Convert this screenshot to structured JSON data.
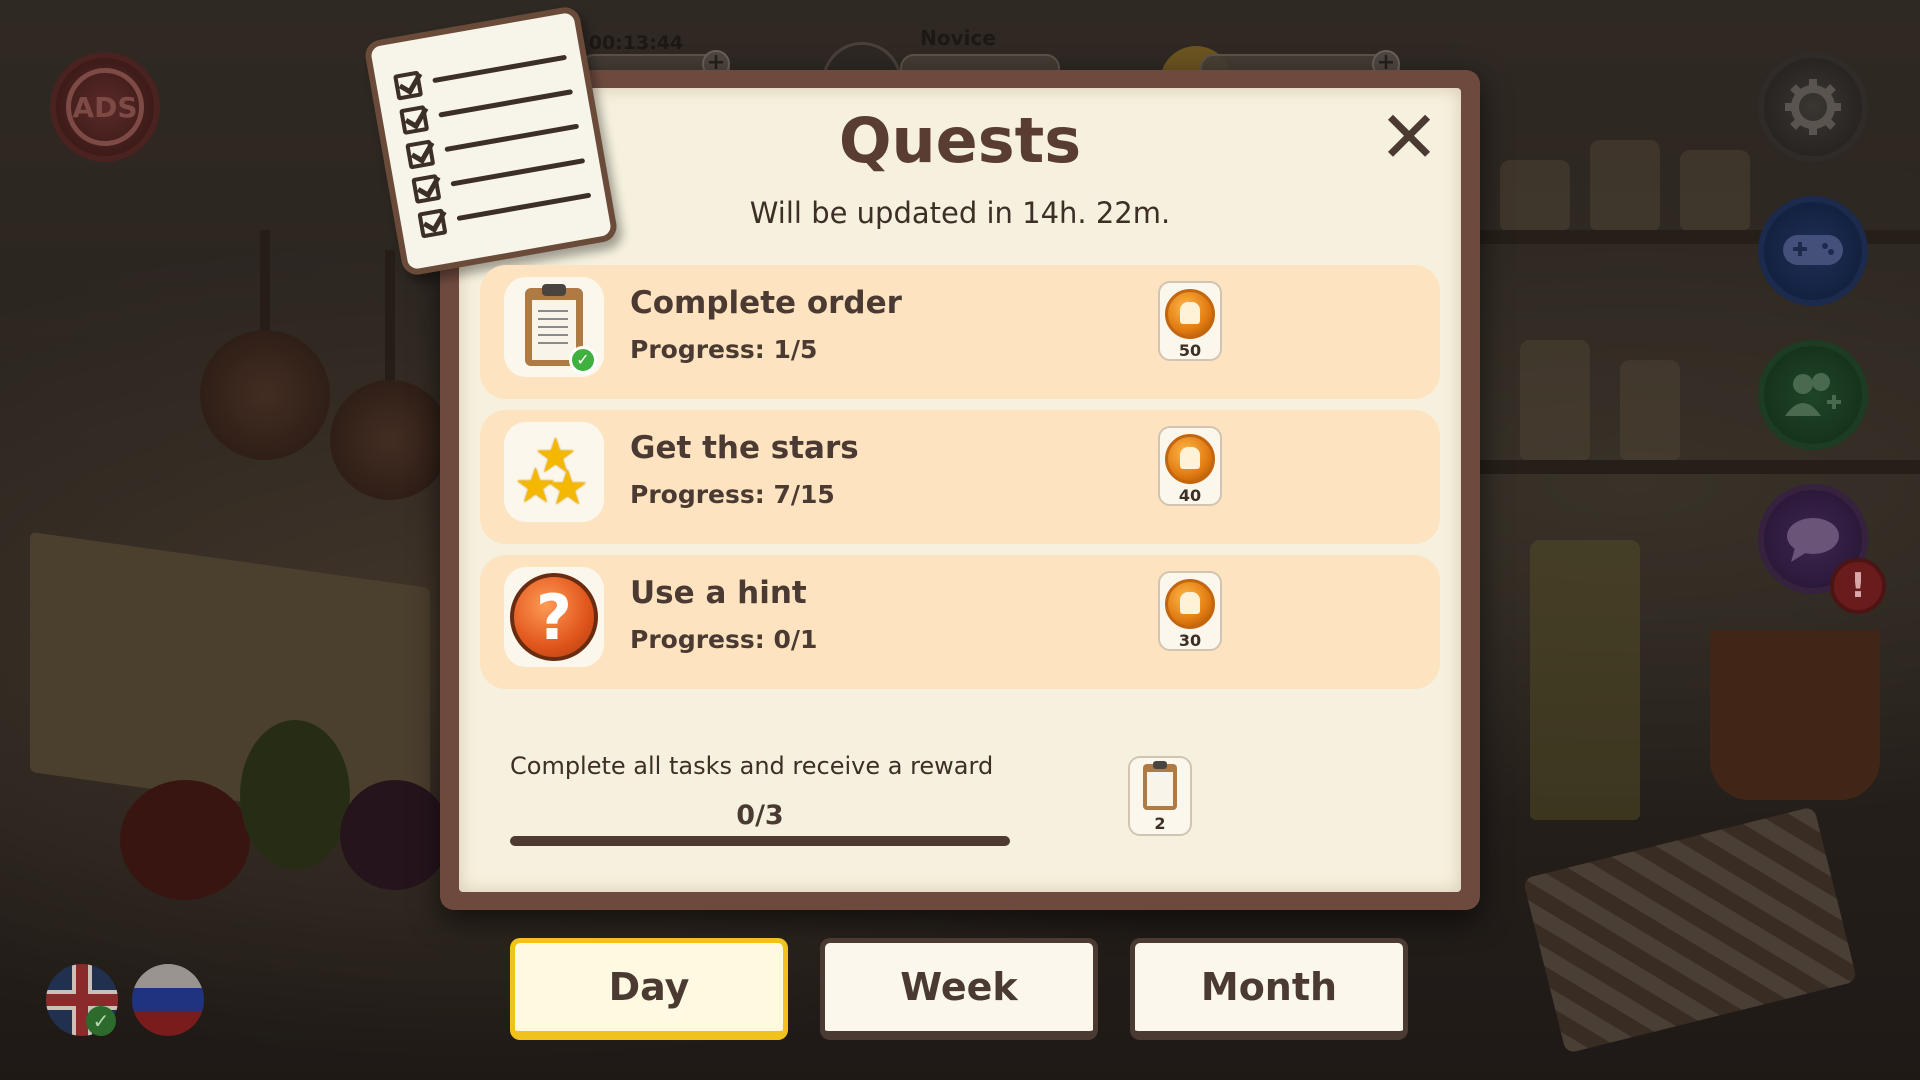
{
  "hud": {
    "timer": "00:13:44",
    "rank": "Novice"
  },
  "side_buttons": {
    "no_ads_label": "ADS"
  },
  "modal": {
    "title": "Quests",
    "subtitle": "Will be updated in 14h. 22m.",
    "close_symbol": "✕"
  },
  "quests": [
    {
      "title": "Complete order",
      "progress": "Progress: 1/5",
      "reward": "50",
      "icon": "clipboard-icon"
    },
    {
      "title": "Get the stars",
      "progress": "Progress: 7/15",
      "reward": "40",
      "icon": "stars-icon"
    },
    {
      "title": "Use a hint",
      "progress": "Progress: 0/1",
      "reward": "30",
      "icon": "hint-icon"
    }
  ],
  "all_tasks": {
    "label": "Complete all tasks and receive a reward",
    "count": "0/3",
    "progress_fraction": 0,
    "reward": "2"
  },
  "tabs": {
    "day": "Day",
    "week": "Week",
    "month": "Month",
    "active": "Day"
  },
  "colors": {
    "modal_frame": "#6e4a3e",
    "paper": "#f6f1de",
    "quest_row": "#fde3c0",
    "active_tab_border": "#f2c21c",
    "title_text": "#5a3d32"
  }
}
